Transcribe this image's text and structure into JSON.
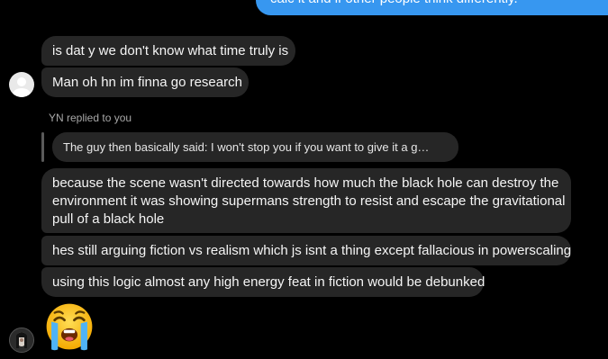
{
  "thread": {
    "outgoing_partial": "calc it and if other people think differently.",
    "messages": [
      "is dat y we don't know what time truly is",
      "Man oh hn im finna go research"
    ],
    "reply": {
      "label": "YN replied to you",
      "quoted_text": "The guy then basically said: I won't stop you if you want to give it a g…"
    },
    "messages2": [
      "because the scene wasn't directed towards how much the black hole can destroy the",
      "environment it was showing supermans strength to resist and escape the gravitational",
      "pull of a black hole",
      "hes still arguing fiction vs realism which js isnt a thing except fallacious in powerscaling",
      "using this logic almost any high energy feat in fiction would be debunked"
    ],
    "reaction_emoji": "loudly-crying-face-emoji"
  },
  "colors": {
    "background": "#000000",
    "incoming_bubble": "#262626",
    "outgoing_bubble": "#3797f0",
    "meta_text": "#a8a8a8"
  }
}
